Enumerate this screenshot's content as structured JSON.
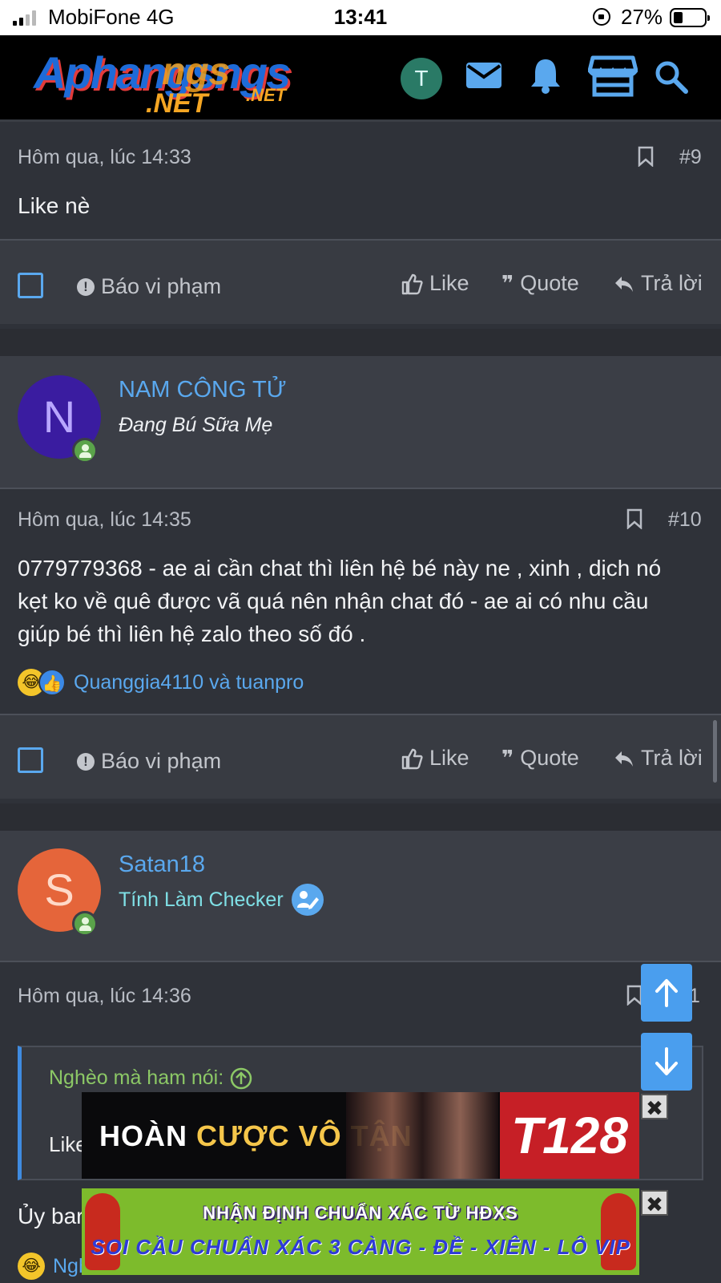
{
  "status": {
    "carrier": "MobiFone   4G",
    "time": "13:41",
    "battery": "27%"
  },
  "header": {
    "logo_line1": "Aphangsngs",
    "logo_line1_overlap": "ngs",
    "logo_line2": ".NET",
    "logo_line2_small": ".NET",
    "avatar_initial": "T",
    "icons": [
      "mail-icon",
      "bell-icon",
      "store-icon",
      "search-icon"
    ]
  },
  "post9": {
    "time": "Hôm qua, lúc 14:33",
    "number": "#9",
    "body": "Like nè",
    "actions": {
      "report": "Báo vi phạm",
      "like": "Like",
      "quote": "Quote",
      "reply": "Trả lời"
    }
  },
  "user10": {
    "initial": "N",
    "name": "NAM CÔNG TỬ",
    "title": "Đang Bú Sữa Mẹ",
    "avatar_color": "#3a1ca0"
  },
  "post10": {
    "time": "Hôm qua, lúc 14:35",
    "number": "#10",
    "body_lines": [
      "0779779368 - ae ai cần chat thì liên hệ bé này ne , xinh , dịch nó",
      "kẹt ko về quê được vã quá nên nhận chat đó - ae ai có nhu cầu",
      "giúp bé thì liên hệ zalo theo số đó ."
    ],
    "reactors": "Quanggia4110 và tuanpro",
    "actions": {
      "report": "Báo vi phạm",
      "like": "Like",
      "quote": "Quote",
      "reply": "Trả lời"
    }
  },
  "user11": {
    "initial": "S",
    "name": "Satan18",
    "title": "Tính Làm Checker",
    "avatar_color": "#e5653a"
  },
  "post11": {
    "time": "Hôm qua, lúc 14:36",
    "number_partial": "1",
    "quote_author": "Nghèo mà ham nói:",
    "quote_body": "Like",
    "body_partial": "Ủy bar",
    "reactors_partial": "Ngh"
  },
  "ads": {
    "banner1_text_a": "HOÀN ",
    "banner1_text_b": "CƯỢC VÔ TẬN",
    "banner1_logo": "T128",
    "banner2_line1": "NHẬN ĐỊNH CHUẨN XÁC TỪ HĐXS",
    "banner2_line2": "SOI CẦU CHUẨN XÁC 3 CÀNG - ĐỀ - XIÊN - LÔ VIP",
    "close": "✖"
  },
  "colors": {
    "accent": "#5aa8ee",
    "background": "#2f3239",
    "online": "#5aa34a"
  }
}
